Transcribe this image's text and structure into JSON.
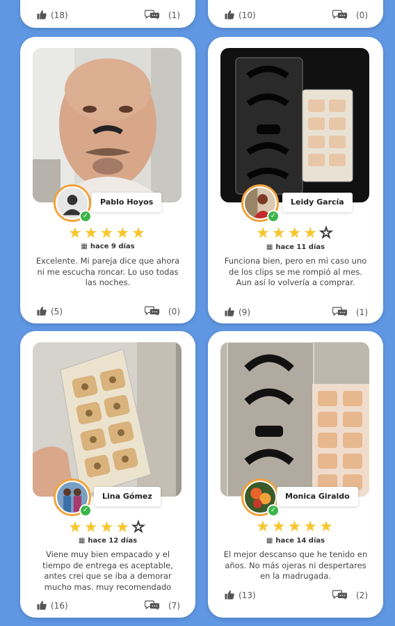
{
  "top_row": [
    {
      "likes": "(18)",
      "comments": "(1)"
    },
    {
      "likes": "(10)",
      "comments": "(0)"
    }
  ],
  "reviews": [
    {
      "name": "Pablo Hoyos",
      "rating": 5,
      "stars": [
        "★",
        "★",
        "★",
        "★",
        "★"
      ],
      "date": "hace 9 días",
      "text": "Excelente. Mi pareja dice que ahora ni me escucha roncar. Lo uso todas las noches.",
      "likes": "(5)",
      "comments": "(0)"
    },
    {
      "name": "Leidy García",
      "rating": 4,
      "stars": [
        "★",
        "★",
        "★",
        "★",
        "☆"
      ],
      "date": "hace 11 días",
      "text": "Funciona bien, pero en mi caso uno de los clips se me rompió al mes. Aun así lo volvería a comprar.",
      "likes": "(9)",
      "comments": "(1)"
    },
    {
      "name": "Lina Gómez",
      "rating": 4,
      "stars": [
        "★",
        "★",
        "★",
        "★",
        "☆"
      ],
      "date": "hace 12 días",
      "text": "Viene muy bien empacado y el tiempo de entrega es aceptable, antes crei que se iba a demorar mucho mas. muy recomendado",
      "likes": "(16)",
      "comments": "(7)"
    },
    {
      "name": "Monica Giraldo",
      "rating": 5,
      "stars": [
        "★",
        "★",
        "★",
        "★",
        "★"
      ],
      "date": "hace 14 días",
      "text": "El mejor descanso que he tenido en años. No más ojeras ni despertares en la madrugada.",
      "likes": "(13)",
      "comments": "(2)"
    }
  ],
  "icons": {
    "like": "thumbs-up-icon",
    "comment": "chat-bubbles-icon",
    "calendar": "calendar-icon",
    "verified": "check-badge-icon"
  },
  "colors": {
    "background": "#5f97e3",
    "star": "#f7c52e",
    "avatar_ring": "#f1a33b",
    "verified": "#3cb54a"
  }
}
